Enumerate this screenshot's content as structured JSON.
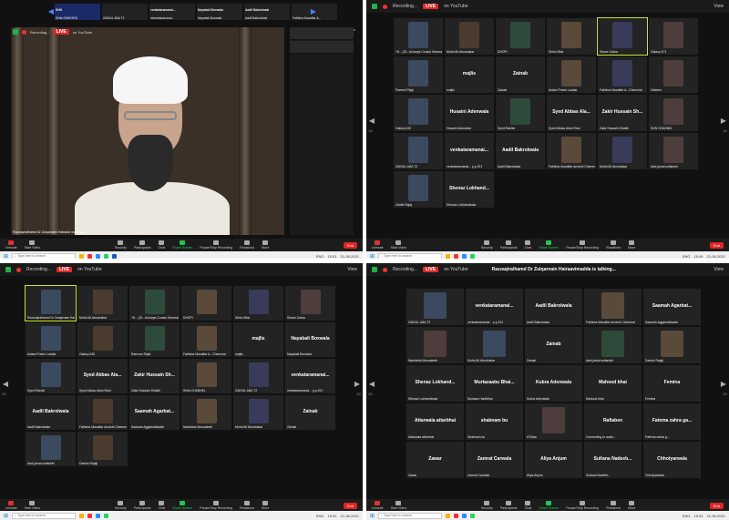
{
  "q1": {
    "header_names": [
      "SNN",
      "ZAINUL ABA TZ",
      "venkataramanai...",
      "Nayabali Boxwala",
      "Aadil Bakrolwala",
      "Fathima Muzaffar A..."
    ],
    "header_subnames": [
      "Shifa SNNFARD",
      "ZAINUL ABA TZ",
      "venkataramanai...",
      "Nayabali Boxwala",
      "Aadil Bakrolwala",
      "Fathima Muzaffar A..."
    ],
    "recording_label": "Recording...",
    "live_label": "LIVE",
    "youtube_label": "on YouTube",
    "view_label": "View",
    "speaker_name": "Razzaqiralhamd Dr Zulqarnain Hairaavi madaswa",
    "toolbar": [
      "Unmute",
      "Start Video",
      "Security",
      "Participants",
      "Chat",
      "Share Screen",
      "Pause/Stop Recording",
      "Reactions",
      "More"
    ],
    "end_label": "End",
    "search_placeholder": "Type here to search",
    "tray_lang": "ENG",
    "tray_time": "15:51",
    "tray_date": "21-06-2021"
  },
  "q2": {
    "recording_label": "Recording...",
    "live_label": "LIVE",
    "youtube_label": "on YouTube",
    "view_label": "View",
    "page_left": "1/2",
    "page_right": "1/2",
    "tiles": [
      {
        "name": "+8... (Ol...Acharya Consul General)",
        "big": ""
      },
      {
        "name": "Mohd Ali Aboobakar",
        "big": ""
      },
      {
        "name": "DHOPI",
        "big": ""
      },
      {
        "name": "Shirin Bhai",
        "big": ""
      },
      {
        "name": "Shane Zahra",
        "big": ""
      },
      {
        "name": "Galaxy A71",
        "big": ""
      },
      {
        "name": "Pareeni Pijaji",
        "big": ""
      },
      {
        "name": "majlis",
        "big": "majlis"
      },
      {
        "name": "Zainab",
        "big": "Zainab"
      },
      {
        "name": "Aslam Pravin Luddar",
        "big": ""
      },
      {
        "name": "Fathima Muzaffar A...Chemmal",
        "big": ""
      },
      {
        "name": "Gabeen",
        "big": ""
      },
      {
        "name": "Galaxy A30",
        "big": ""
      },
      {
        "name": "Husaini Adenwala",
        "big": "Husaini Adenwala"
      },
      {
        "name": "Syed Rashid",
        "big": ""
      },
      {
        "name": "Syed Abbas Alam Rizvi",
        "big": "Syed Abbas Ala..."
      },
      {
        "name": "Zakir Hussain Shaikh",
        "big": "Zakir Hussain Sh..."
      },
      {
        "name": "SNN CHANNEL",
        "big": ""
      },
      {
        "name": "ZAINUL ABA TZ",
        "big": ""
      },
      {
        "name": "venkataramanai... p.p.191",
        "big": "venkataramanai..."
      },
      {
        "name": "Aadil Bakrolwala",
        "big": "Aadil Bakrolwala"
      },
      {
        "name": "Fathima Muzaffar Armishi Chemmal...",
        "big": ""
      },
      {
        "name": "Mohd Ali Aboobakar",
        "big": ""
      },
      {
        "name": "dani jamal sultanbhi",
        "big": ""
      },
      {
        "name": "Zainib Rajaj",
        "big": ""
      },
      {
        "name": "Shenaz Lokhandwala",
        "big": "Shenaz Lokhand..."
      }
    ],
    "toolbar": [
      "Unmute",
      "Start Video",
      "Security",
      "Participants",
      "Chat",
      "Share Screen",
      "Pause/Stop Recording",
      "Reactions",
      "More"
    ],
    "end_label": "End",
    "search_placeholder": "Type here to search",
    "tray_lang": "ENG",
    "tray_time": "15:49",
    "tray_date": "21-06-2021"
  },
  "q3": {
    "recording_label": "Recording...",
    "live_label": "LIVE",
    "youtube_label": "on YouTube",
    "view_label": "View",
    "page_left": "1/2",
    "page_right": "1/2",
    "tiles": [
      {
        "name": "Razzaqiralhamd Dr Zulqarnain Hairaavi",
        "big": ""
      },
      {
        "name": "Mohd Ali Aboobakar",
        "big": ""
      },
      {
        "name": "+8... (Ol...Acharya Consul General)",
        "big": ""
      },
      {
        "name": "DHOPI",
        "big": ""
      },
      {
        "name": "Shirin Bhai",
        "big": ""
      },
      {
        "name": "Shane Zahra",
        "big": ""
      },
      {
        "name": "Aslam Pravin Luddar",
        "big": ""
      },
      {
        "name": "Galaxy A30",
        "big": ""
      },
      {
        "name": "Ramzan Rajai",
        "big": ""
      },
      {
        "name": "Fathima Muzaffar A...Chemmal",
        "big": ""
      },
      {
        "name": "majlis",
        "big": "majlis"
      },
      {
        "name": "Nayabali Boxwala",
        "big": "Nayabali Boxwala"
      },
      {
        "name": "Syed Rashid",
        "big": ""
      },
      {
        "name": "Syed Abbas Alam Rizvi",
        "big": "Syed Abbas Ala..."
      },
      {
        "name": "Zakir Hussain Shaikh",
        "big": "Zakir Hussain Sh..."
      },
      {
        "name": "Shifa CHANNEL",
        "big": ""
      },
      {
        "name": "ZAINUL ABA TZ",
        "big": ""
      },
      {
        "name": "venkataramanai... p.p.191",
        "big": "venkataramanai..."
      },
      {
        "name": "Aadil Bakrolwala",
        "big": "Aadil Bakrolwala"
      },
      {
        "name": "Fathima Muzaffar Armishi Chemmal",
        "big": ""
      },
      {
        "name": "Saamah Aggarbattiwala",
        "big": "Saamah Agarbat..."
      },
      {
        "name": "Nasirbeta Moosaleeb",
        "big": ""
      },
      {
        "name": "Mohd Ali Aboobakar",
        "big": ""
      },
      {
        "name": "Zainab",
        "big": "Zainab"
      },
      {
        "name": "dani jamal sultanbhi",
        "big": ""
      },
      {
        "name": "Danish Rajaji",
        "big": ""
      }
    ],
    "toolbar": [
      "Unmute",
      "Start Video",
      "Security",
      "Participants",
      "Chat",
      "Share Screen",
      "Pause/Stop Recording",
      "Reactions",
      "More"
    ],
    "end_label": "End",
    "search_placeholder": "Type here to search",
    "tray_lang": "ENG",
    "tray_time": "15:51",
    "tray_date": "21-06-2021"
  },
  "q4": {
    "recording_label": "Recording...",
    "live_label": "LIVE",
    "youtube_label": "on YouTube",
    "view_label": "View",
    "speaking_banner": "Razzaqiralhamd Dr Zulqarnain Hairaavimadda is talking...",
    "page_left": "2/2",
    "page_right": "2/2",
    "tiles": [
      {
        "name": "ZAINUL ABA TZ",
        "big": ""
      },
      {
        "name": "venkataramanai... p.p.191",
        "big": "venkataramanai..."
      },
      {
        "name": "Aadil Bakrolwala",
        "big": "Aadil Bakrolwala"
      },
      {
        "name": "Fathima Muzaffar Armishi Chemmal",
        "big": ""
      },
      {
        "name": "Saamah Aggarbattiwala",
        "big": "Saamah Agarbat..."
      },
      {
        "name": "Nasirbeta Moosaleeb",
        "big": ""
      },
      {
        "name": "Mohd Ali Aboobakar",
        "big": ""
      },
      {
        "name": "Zainab",
        "big": "Zainab"
      },
      {
        "name": "dani jamal sultanbhi",
        "big": ""
      },
      {
        "name": "Danish Rajaji",
        "big": ""
      },
      {
        "name": "Shenaz Lokhandwala",
        "big": "Shenaz Lokhand..."
      },
      {
        "name": "Murtaza Hanifbhai",
        "big": "Murtazaabu Bhai..."
      },
      {
        "name": "Kubra Adenwala",
        "big": "Kubra Adenwala"
      },
      {
        "name": "Mahood bhai",
        "big": "Mahood bhai"
      },
      {
        "name": "Femina",
        "big": "Femina"
      },
      {
        "name": "Attarwala attarbhai",
        "big": "Attarwala attarbhai"
      },
      {
        "name": "Shabnam bu",
        "big": "shabnam bu"
      },
      {
        "name": "ATMaa",
        "big": ""
      },
      {
        "name": "Connecting to audio...",
        "big": "Rafiaben"
      },
      {
        "name": "Fatema zahra g...",
        "big": "Fatema zahra ga..."
      },
      {
        "name": "Zawar",
        "big": "Zawar"
      },
      {
        "name": "Zamrat Carwala",
        "big": "Zamrat Carwala"
      },
      {
        "name": "Aliya Anjum",
        "big": "Aliya Anjum"
      },
      {
        "name": "Sultana Nadeeb...",
        "big": "Sultana Nadeeb..."
      },
      {
        "name": "Chhotyarwala",
        "big": "Chhotyarwala"
      }
    ],
    "toolbar": [
      "Unmute",
      "Start Video",
      "Security",
      "Participants",
      "Chat",
      "Share Screen",
      "Pause/Stop Recording",
      "Reactions",
      "More"
    ],
    "end_label": "End",
    "search_placeholder": "Type here to search",
    "tray_lang": "ENG",
    "tray_time": "15:24",
    "tray_date": "21-06-2021"
  },
  "colors": {
    "live_red": "#e02828",
    "end_red": "#e02424",
    "share_green": "#23c552",
    "speaking_outline": "#c9e52f"
  }
}
